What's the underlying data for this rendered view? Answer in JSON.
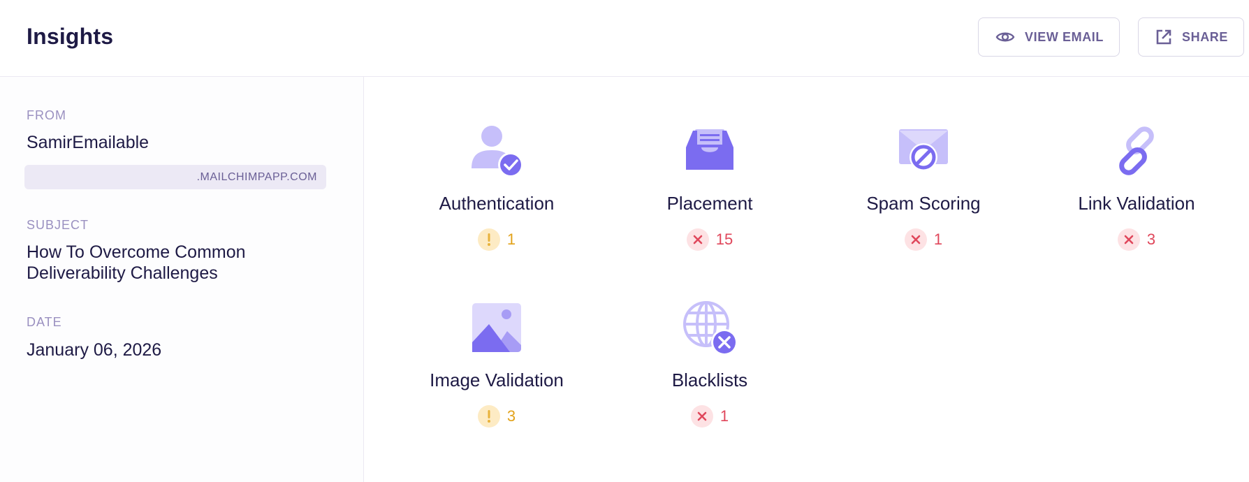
{
  "header": {
    "title": "Insights",
    "view_email_label": "VIEW EMAIL",
    "share_label": "SHARE"
  },
  "sidebar": {
    "from_label": "FROM",
    "from_value": "SamirEmailable",
    "from_domain": ".MAILCHIMPAPP.COM",
    "subject_label": "SUBJECT",
    "subject_line1": "How To Overcome Common",
    "subject_line2": "Deliverability Challenges",
    "date_label": "DATE",
    "date_value": "January 06, 2026"
  },
  "tiles": [
    {
      "name": "Authentication",
      "icon": "user-check-icon",
      "status": "warning",
      "count": "1"
    },
    {
      "name": "Placement",
      "icon": "inbox-tray-icon",
      "status": "error",
      "count": "15"
    },
    {
      "name": "Spam Scoring",
      "icon": "envelope-ban-icon",
      "status": "error",
      "count": "1"
    },
    {
      "name": "Link Validation",
      "icon": "link-icon",
      "status": "error",
      "count": "3"
    },
    {
      "name": "Image Validation",
      "icon": "image-icon",
      "status": "warning",
      "count": "3"
    },
    {
      "name": "Blacklists",
      "icon": "globe-x-icon",
      "status": "error",
      "count": "1"
    }
  ],
  "colors": {
    "accent": "#7b6cf0",
    "accent_light": "#c6bffa",
    "warning": "#e2a21a",
    "error": "#e0475b"
  }
}
